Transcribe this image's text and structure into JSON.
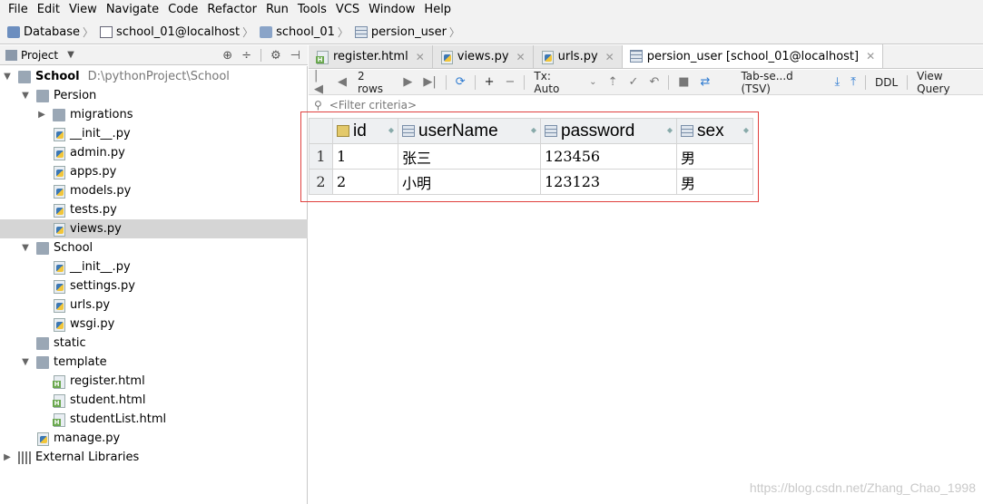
{
  "menu": [
    "File",
    "Edit",
    "View",
    "Navigate",
    "Code",
    "Refactor",
    "Run",
    "Tools",
    "VCS",
    "Window",
    "Help"
  ],
  "breadcrumb": [
    "Database",
    "school_01@localhost",
    "school_01",
    "persion_user"
  ],
  "project_panel": {
    "title": "Project"
  },
  "tree": {
    "root": {
      "label": "School",
      "path": "D:\\pythonProject\\School"
    },
    "items": [
      "Persion",
      "migrations",
      "__init__.py",
      "admin.py",
      "apps.py",
      "models.py",
      "tests.py",
      "views.py",
      "School",
      "__init__.py",
      "settings.py",
      "urls.py",
      "wsgi.py",
      "static",
      "template",
      "register.html",
      "student.html",
      "studentList.html",
      "manage.py",
      "External Libraries"
    ]
  },
  "tabs": [
    "register.html",
    "views.py",
    "urls.py",
    "persion_user [school_01@localhost]"
  ],
  "toolbar": {
    "rows": "2 rows",
    "tx": "Tx: Auto",
    "export": "Tab-se...d (TSV)",
    "ddl": "DDL",
    "view_query": "View Query"
  },
  "filter": {
    "placeholder": "<Filter criteria>"
  },
  "grid": {
    "columns": [
      "id",
      "userName",
      "password",
      "sex"
    ],
    "rows": [
      {
        "num": "1",
        "id": "1",
        "userName": "张三",
        "password": "123456",
        "sex": "男"
      },
      {
        "num": "2",
        "id": "2",
        "userName": "小明",
        "password": "123123",
        "sex": "男"
      }
    ]
  },
  "watermark": "https://blog.csdn.net/Zhang_Chao_1998",
  "colors": {
    "highlight": "#e0403e",
    "selected_row": "#d5d5d5"
  }
}
